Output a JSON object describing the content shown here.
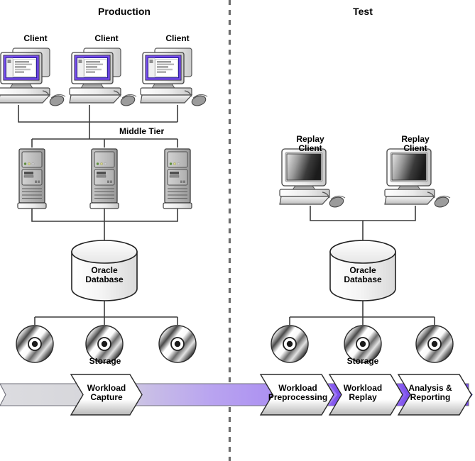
{
  "diagram": {
    "title_production": "Production",
    "title_test": "Test",
    "divider": "vertical-dashed-divider"
  },
  "production": {
    "clients": [
      {
        "label": "Client",
        "icon": "desktop-computer-icon"
      },
      {
        "label": "Client",
        "icon": "desktop-computer-icon"
      },
      {
        "label": "Client",
        "icon": "desktop-computer-icon"
      }
    ],
    "middle_tier_label": "Middle Tier",
    "servers": [
      {
        "icon": "server-tower-icon"
      },
      {
        "icon": "server-tower-icon"
      },
      {
        "icon": "server-tower-icon"
      }
    ],
    "database": {
      "label": "Oracle\nDatabase",
      "icon": "database-cylinder-icon"
    },
    "storage_label": "Storage",
    "storage": [
      {
        "icon": "disc-storage-icon"
      },
      {
        "icon": "disc-storage-icon"
      },
      {
        "icon": "disc-storage-icon"
      }
    ]
  },
  "test": {
    "clients": [
      {
        "label": "Replay\nClient",
        "icon": "desktop-computer-icon"
      },
      {
        "label": "Replay\nClient",
        "icon": "desktop-computer-icon"
      }
    ],
    "database": {
      "label": "Oracle\nDatabase",
      "icon": "database-cylinder-icon"
    },
    "storage_label": "Storage",
    "storage": [
      {
        "icon": "disc-storage-icon"
      },
      {
        "icon": "disc-storage-icon"
      },
      {
        "icon": "disc-storage-icon"
      }
    ]
  },
  "process_flow": {
    "steps": [
      {
        "label": "Workload\nCapture"
      },
      {
        "label": "Workload\nPreprocessing"
      },
      {
        "label": "Workload\nReplay"
      },
      {
        "label": "Analysis &\nReporting"
      }
    ],
    "band_start_color": "#d8d8dd",
    "band_end_color": "#8855f5",
    "terminal_arrow_color": "#1a1aa8"
  },
  "colors": {
    "outline": "#333333",
    "screen_border_purple": "#4a22b8",
    "metal_light": "#f2f2f2",
    "metal_mid": "#b9b9b9",
    "server_body": "#a9a9a9"
  }
}
